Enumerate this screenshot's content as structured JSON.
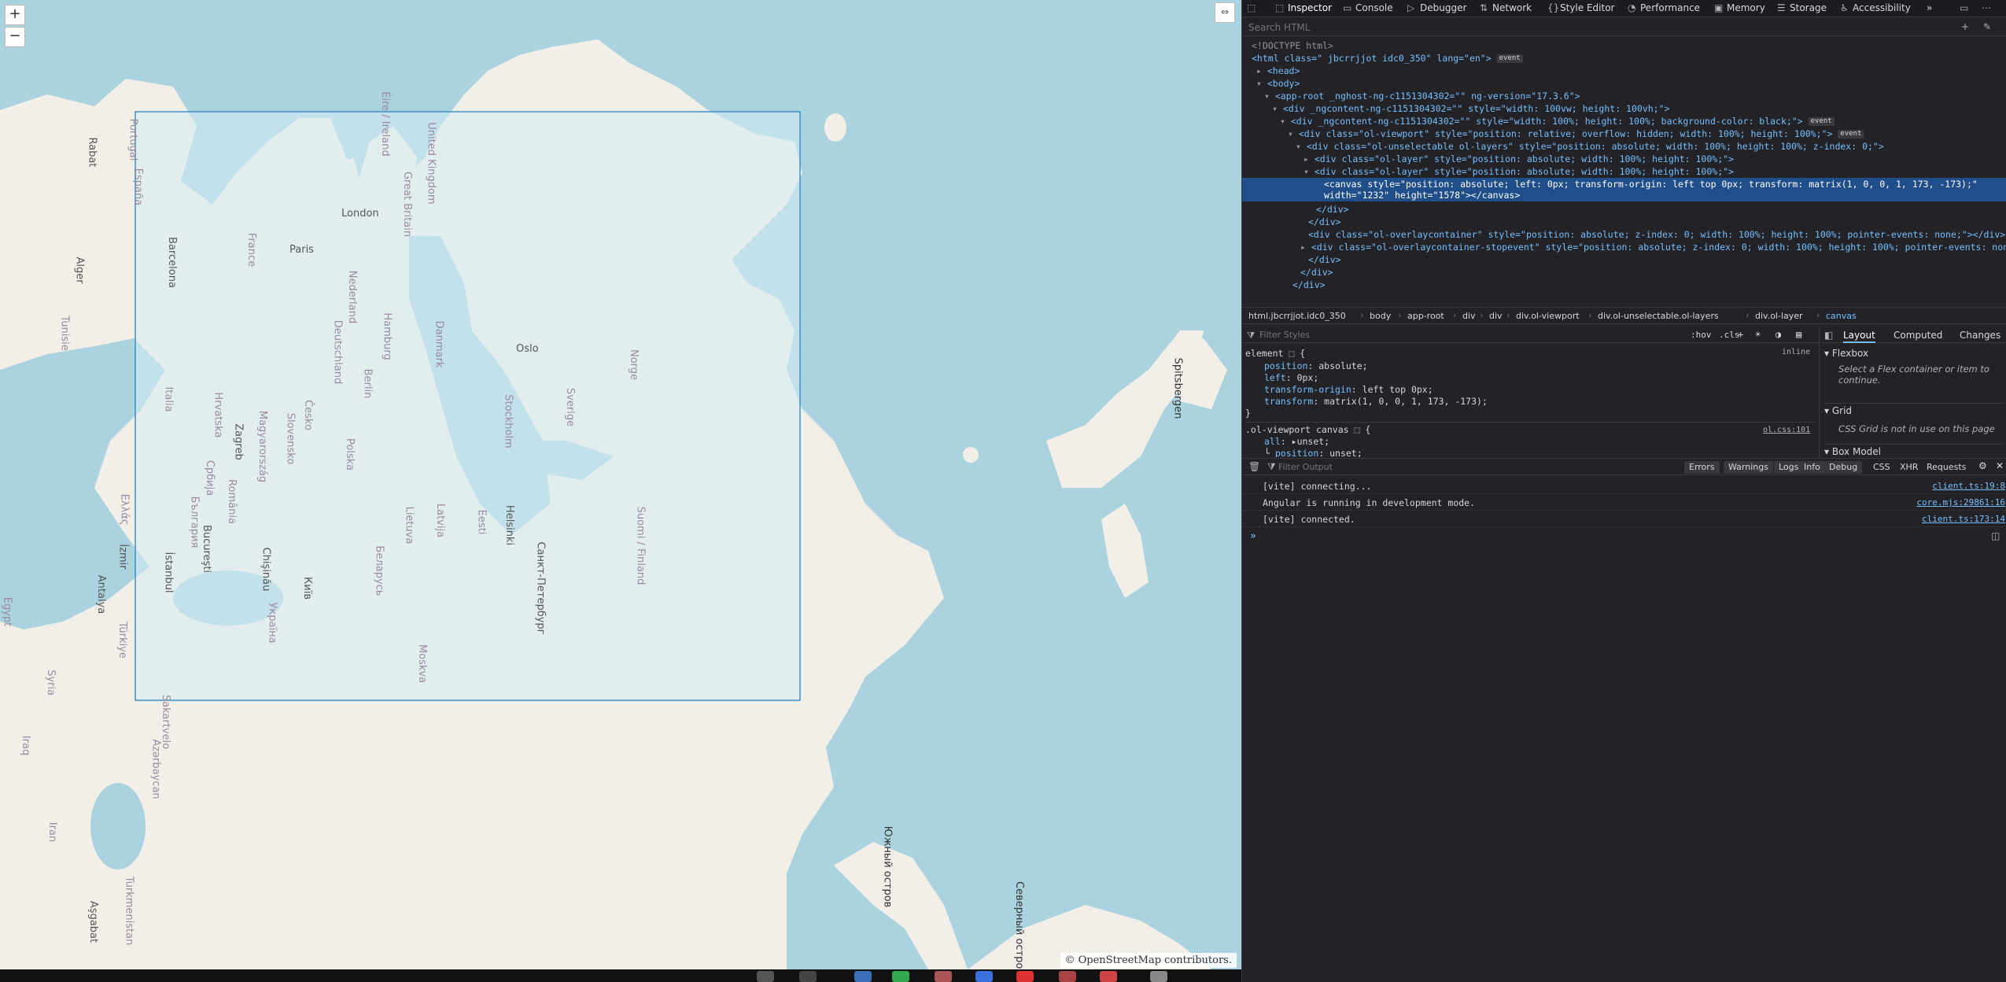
{
  "map": {
    "zoom_in_label": "+",
    "zoom_out_label": "−",
    "fullscreen_label": "⇔",
    "attribution": "© OpenStreetMap contributors.",
    "colors": {
      "water": "#aad3df",
      "land": "#f2efe9",
      "overlay": "#d6ecf3",
      "overlay_border": "#3f8fc6"
    },
    "labels": [
      "Oslo",
      "Stockholm",
      "London",
      "Paris",
      "Berlin",
      "Hamburg",
      "Moskva",
      "Sverige",
      "Norge",
      "Suomi / Finland",
      "Deutschland",
      "France",
      "España",
      "Portugal",
      "Italia",
      "Polska",
      "Danmark",
      "Éire / Ireland",
      "United Kingdom",
      "Great Britain",
      "Nederland",
      "Latvija",
      "Lietuva",
      "Eesti",
      "Helsinki",
      "Санкт-Петербург",
      "Беларусь",
      "Україна",
      "Київ",
      "România",
      "Magyarország",
      "Slovensko",
      "Česko",
      "Hrvatska",
      "Zagreb",
      "Србија",
      "България",
      "Bucureşti",
      "Chişinău",
      "Ελλάς",
      "İzmir",
      "İstanbul",
      "Antalya",
      "Türkiye",
      "Barcelona",
      "Alger",
      "Rabat",
      "Spitsbergen",
      "Южный остров",
      "Северный остров",
      "Turkmenistan",
      "Aşgabat",
      "Azərbaycan",
      "Sakartvelo",
      "Tunisie",
      "Iraq",
      "Syria",
      "Egypt",
      "Iran"
    ]
  },
  "devtools": {
    "tabs": [
      {
        "icon": "⬚",
        "label": "Inspector"
      },
      {
        "icon": "▭",
        "label": "Console"
      },
      {
        "icon": "▷",
        "label": "Debugger"
      },
      {
        "icon": "⇅",
        "label": "Network"
      },
      {
        "icon": "{}",
        "label": "Style Editor"
      },
      {
        "icon": "◔",
        "label": "Performance"
      },
      {
        "icon": "▣",
        "label": "Memory"
      },
      {
        "icon": "☰",
        "label": "Storage"
      },
      {
        "icon": "♿",
        "label": "Accessibility"
      }
    ],
    "more_tabs": "»",
    "search_placeholder": "Search HTML",
    "html_tree": [
      "<!DOCTYPE html>",
      "<html class=\" jbcrrjjot idc0_350\" lang=\"en\">",
      "<head>",
      "<body>",
      "<app-root _nghost-ng-c1151304302=\"\" ng-version=\"17.3.6\">",
      "<div _ngcontent-ng-c1151304302=\"\" style=\"width: 100vw; height: 100vh;\">",
      "<div _ngcontent-ng-c1151304302=\"\" style=\"width: 100%; height: 100%; background-color: black;\">",
      "<div class=\"ol-viewport\" style=\"position: relative; overflow: hidden; width: 100%; height: 100%;\">",
      "<div class=\"ol-unselectable ol-layers\" style=\"position: absolute; width: 100%; height: 100%; z-index: 0;\">",
      "<div class=\"ol-layer\" style=\"position: absolute; width: 100%; height: 100%;\">",
      "<div class=\"ol-layer\" style=\"position: absolute; width: 100%; height: 100%;\">",
      "<canvas style=\"position: absolute; left: 0px; transform-origin: left top 0px; transform: matrix(1, 0, 0, 1, 173, -173);\"",
      "width=\"1232\" height=\"1578\"></canvas>",
      "</div>",
      "</div>",
      "<div class=\"ol-overlaycontainer\" style=\"position: absolute; z-index: 0; width: 100%; height: 100%; pointer-events: none;\"></div>",
      "<div class=\"ol-overlaycontainer-stopevent\" style=\"position: absolute; z-index: 0; width: 100%; height: 100%; pointer-events: none;\">",
      "</div>",
      "</div>",
      "</div>"
    ],
    "event_badge": "event",
    "breadcrumbs": [
      "html.jbcrrjjot.idc0_350",
      "body",
      "app-root",
      "div",
      "div",
      "div.ol-viewport",
      "div.ol-unselectable.ol-layers",
      "div.ol-layer",
      "canvas"
    ],
    "rules": {
      "filter_placeholder": "Filter Styles",
      "toolbar_buttons": [
        ":hov",
        ".cls",
        "+"
      ],
      "element_selector": "element",
      "inline_label": "inline",
      "element_props": [
        {
          "name": "position",
          "value": "absolute;"
        },
        {
          "name": "left",
          "value": "0px;"
        },
        {
          "name": "transform-origin",
          "value": "left top 0px;"
        },
        {
          "name": "transform",
          "value": "matrix(1, 0, 0, 1, 173, -173);"
        }
      ],
      "second_selector": ".ol-viewport canvas",
      "second_source": "ol.css:101",
      "second_props": [
        {
          "name": "all",
          "value": "unset;"
        },
        {
          "name": "position",
          "value": "unset;"
        }
      ]
    },
    "layout_tabs": [
      "Layout",
      "Computed",
      "Changes"
    ],
    "flexbox_title": "Flexbox",
    "flexbox_text": "Select a Flex container or item to continue.",
    "grid_title": "Grid",
    "grid_text": "CSS Grid is not in use on this page",
    "box_model_title": "Box Model",
    "console": {
      "filter_placeholder": "Filter Output",
      "level_buttons": [
        "Errors",
        "Warnings",
        "Logs",
        "Info",
        "Debug"
      ],
      "type_buttons": [
        "CSS",
        "XHR",
        "Requests"
      ],
      "messages": [
        {
          "text": "[vite] connecting...",
          "source": "client.ts:19:8"
        },
        {
          "text": "Angular is running in development mode.",
          "source": "core.mjs:29861:16"
        },
        {
          "text": "[vite] connected.",
          "source": "client.ts:173:14"
        }
      ],
      "prompt": "»"
    }
  }
}
